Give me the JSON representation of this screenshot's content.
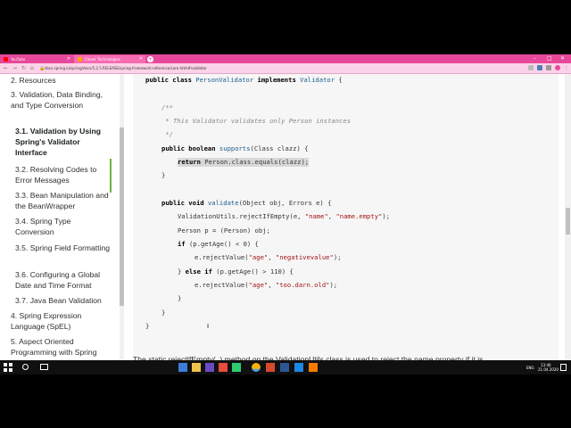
{
  "browser": {
    "tabs": [
      {
        "label": "YouTube",
        "active": false
      },
      {
        "label": "Clever Technologies",
        "active": true
      }
    ],
    "url": "docs.spring.io/spring/docs/5.2.5.RELEASE/spring-framework-reference/core.html#validator"
  },
  "sidebar": {
    "items": [
      {
        "label": "2. Resources",
        "level": 1
      },
      {
        "label": "3. Validation, Data Binding, and Type Conversion",
        "level": 1
      },
      {
        "label": "3.1. Validation by Using Spring's Validator Interface",
        "level": 2,
        "active": true
      },
      {
        "label": "3.2. Resolving Codes to Error Messages",
        "level": 2
      },
      {
        "label": "3.3. Bean Manipulation and the BeanWrapper",
        "level": 2
      },
      {
        "label": "3.4. Spring Type Conversion",
        "level": 2
      },
      {
        "label": "3.5. Spring Field Formatting",
        "level": 2
      },
      {
        "label": "3.6. Configuring a Global Date and Time Format",
        "level": 2
      },
      {
        "label": "3.7. Java Bean Validation",
        "level": 2
      },
      {
        "label": "4. Spring Expression Language (SpEL)",
        "level": 1
      },
      {
        "label": "5. Aspect Oriented Programming with Spring",
        "level": 1
      }
    ]
  },
  "code": {
    "l1a": "public class ",
    "l1b": "PersonValidator",
    "l1c": " implements ",
    "l1d": "Validator",
    "l1e": " {",
    "c1": "/**",
    "c2": " * This Validator validates only Person instances",
    "c3": " */",
    "l2a": "public boolean ",
    "l2b": "supports",
    "l2c": "(Class clazz) {",
    "l3a": "return",
    "l3b": " Person.class.equals(clazz);",
    "l4": "}",
    "l5a": "public void ",
    "l5b": "validate",
    "l5c": "(Object obj, Errors e) {",
    "l6a": "ValidationUtils.rejectIfEmpty(e, ",
    "l6b": "\"name\"",
    "l6c": ", ",
    "l6d": "\"name.empty\"",
    "l6e": ");",
    "l7": "Person p = (Person) obj;",
    "l8a": "if",
    "l8b": " (p.getAge() < 0) {",
    "l9a": "e.rejectValue(",
    "l9b": "\"age\"",
    "l9c": ", ",
    "l9d": "\"negativevalue\"",
    "l9e": ");",
    "l10a": "} ",
    "l10b": "else if",
    "l10c": " (p.getAge() > 110) {",
    "l11a": "e.rejectValue(",
    "l11b": "\"age\"",
    "l11c": ", ",
    "l11d": "\"too.darn.old\"",
    "l11e": ");",
    "l12": "}",
    "l13": "}",
    "l14": "}"
  },
  "footer": "The static rejectIfEmpty(..) method on the ValidationUtils class is used to reject the name property if it is",
  "taskbar": {
    "clock_time": "13:46",
    "clock_date": "21.04.2020",
    "lang": "ENG"
  },
  "colors": {
    "tab_strip": "#e8489a",
    "active_marker": "#6db33f"
  }
}
